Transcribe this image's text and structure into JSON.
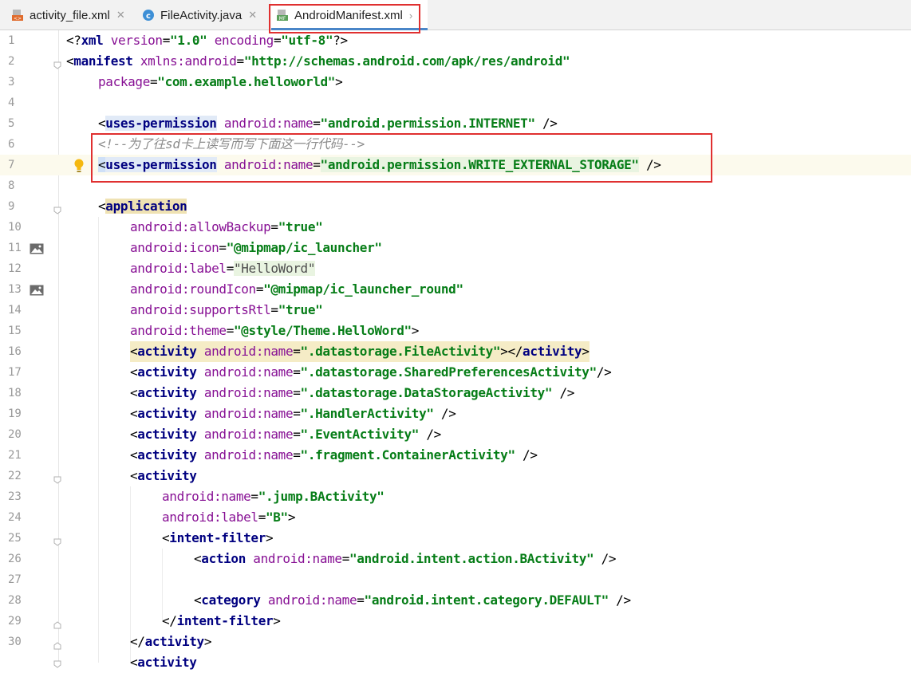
{
  "tabs": [
    {
      "label": "activity_file.xml",
      "icon": "xml-file-icon"
    },
    {
      "label": "FileActivity.java",
      "icon": "java-class-icon"
    },
    {
      "label": "AndroidManifest.xml",
      "icon": "manifest-file-icon",
      "active": true
    }
  ],
  "colors": {
    "highlight_box": "#e03030",
    "tab_active_underline": "#4a86c8"
  },
  "lines": [
    {
      "num": "1"
    },
    {
      "num": "2"
    },
    {
      "num": "3"
    },
    {
      "num": "4"
    },
    {
      "num": "5"
    },
    {
      "num": "6"
    },
    {
      "num": "7"
    },
    {
      "num": "8"
    },
    {
      "num": "9"
    },
    {
      "num": "10"
    },
    {
      "num": "11"
    },
    {
      "num": "12"
    },
    {
      "num": "13"
    },
    {
      "num": "14"
    },
    {
      "num": "15"
    },
    {
      "num": "16"
    },
    {
      "num": "17"
    },
    {
      "num": "18"
    },
    {
      "num": "19"
    },
    {
      "num": "20"
    },
    {
      "num": "21"
    },
    {
      "num": "22"
    },
    {
      "num": "23"
    },
    {
      "num": "24"
    },
    {
      "num": "25"
    },
    {
      "num": "26"
    },
    {
      "num": "27"
    },
    {
      "num": "28"
    },
    {
      "num": "29"
    },
    {
      "num": "30"
    }
  ],
  "code": {
    "l1": {
      "open": "<?",
      "tag": "xml",
      "a1": " version",
      "eq": "=",
      "v1": "\"1.0\"",
      "a2": " encoding",
      "v2": "\"utf-8\"",
      "close": "?>"
    },
    "l2": {
      "open": "<",
      "tag": "manifest",
      "ns": " xmlns:",
      "attr": "android",
      "v": "\"http://schemas.android.com/apk/res/android\""
    },
    "l3": {
      "attr": "package",
      "v": "\"com.example.helloworld\"",
      "close": ">"
    },
    "l5": {
      "tag": "uses-permission",
      "ns": " android:",
      "attr": "name",
      "v": "\"android.permission.INTERNET\"",
      "close": " />"
    },
    "l6": {
      "comment": "<!--为了往sd卡上读写而写下面这一行代码-->"
    },
    "l7": {
      "tag": "uses-permission",
      "ns": " android:",
      "attr": "name",
      "v": "\"android.permission.WRITE_EXTERNAL_STORAGE\"",
      "close": " />"
    },
    "l9": {
      "tag": "application"
    },
    "l10": {
      "ns": "android:",
      "attr": "allowBackup",
      "v": "\"true\""
    },
    "l11": {
      "ns": "android:",
      "attr": "icon",
      "v": "\"@mipmap/ic_launcher\""
    },
    "l12": {
      "ns": "android:",
      "attr": "label",
      "v": "\"HelloWord\""
    },
    "l13": {
      "ns": "android:",
      "attr": "roundIcon",
      "v": "\"@mipmap/ic_launcher_round\""
    },
    "l14": {
      "ns": "android:",
      "attr": "supportsRtl",
      "v": "\"true\""
    },
    "l15": {
      "ns": "android:",
      "attr": "theme",
      "v": "\"@style/Theme.HelloWord\"",
      "close": ">"
    },
    "l16": {
      "tag": "activity",
      "ns": " android:",
      "attr": "name",
      "v": "\".datastorage.FileActivity\"",
      "mid": "></",
      "tag2": "activity",
      "close": ">"
    },
    "l17": {
      "tag": "activity",
      "ns": " android:",
      "attr": "name",
      "v": "\".datastorage.SharedPreferencesActivity\"",
      "close": "/>"
    },
    "l18": {
      "tag": "activity",
      "ns": " android:",
      "attr": "name",
      "v": "\".datastorage.DataStorageActivity\"",
      "close": " />"
    },
    "l19": {
      "tag": "activity",
      "ns": " android:",
      "attr": "name",
      "v": "\".HandlerActivity\"",
      "close": " />"
    },
    "l20": {
      "tag": "activity",
      "ns": " android:",
      "attr": "name",
      "v": "\".EventActivity\"",
      "close": " />"
    },
    "l21": {
      "tag": "activity",
      "ns": " android:",
      "attr": "name",
      "v": "\".fragment.ContainerActivity\"",
      "close": " />"
    },
    "l22": {
      "tag": "activity"
    },
    "l23": {
      "ns": "android:",
      "attr": "name",
      "v": "\".jump.BActivity\""
    },
    "l24": {
      "ns": "android:",
      "attr": "label",
      "v": "\"B\"",
      "close": ">"
    },
    "l25": {
      "tag": "intent-filter",
      "close": ">"
    },
    "l26": {
      "tag": "action",
      "ns": " android:",
      "attr": "name",
      "v": "\"android.intent.action.BActivity\"",
      "close": " />"
    },
    "l28": {
      "tag": "category",
      "ns": " android:",
      "attr": "name",
      "v": "\"android.intent.category.DEFAULT\"",
      "close": " />"
    },
    "l29": {
      "tag": "intent-filter",
      "close": ">"
    },
    "l30": {
      "tag": "activity",
      "close": ">"
    },
    "l31": {
      "tag": "activity"
    }
  }
}
